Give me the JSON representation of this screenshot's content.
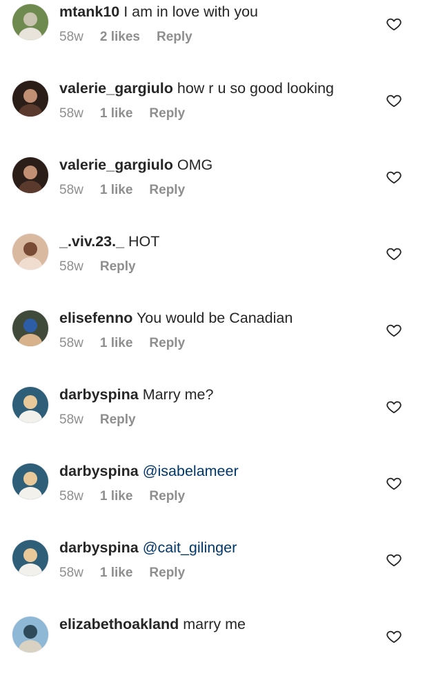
{
  "comments": [
    {
      "username": "mtank10",
      "text": "I am in love with you",
      "age": "58w",
      "likes": "2 likes",
      "reply": "Reply",
      "mention": false,
      "avatar": "avatar-outdoor-photo",
      "avatar_colors": [
        "#6f8a4e",
        "#c9c4b0",
        "#e8e4dc"
      ]
    },
    {
      "username": "valerie_gargiulo",
      "text": "how r u so good looking",
      "age": "58w",
      "likes": "1 like",
      "reply": "Reply",
      "mention": false,
      "avatar": "avatar-portrait-photo",
      "avatar_colors": [
        "#2b1d18",
        "#c08f74",
        "#5a3a2c"
      ]
    },
    {
      "username": "valerie_gargiulo",
      "text": "OMG",
      "age": "58w",
      "likes": "1 like",
      "reply": "Reply",
      "mention": false,
      "avatar": "avatar-portrait-photo",
      "avatar_colors": [
        "#2b1d18",
        "#c08f74",
        "#5a3a2c"
      ]
    },
    {
      "username": "_.viv.23._",
      "text": "HOT",
      "age": "58w",
      "likes": "",
      "reply": "Reply",
      "mention": false,
      "avatar": "avatar-portrait-photo",
      "avatar_colors": [
        "#d9b9a0",
        "#7a4b34",
        "#f1ddd0"
      ]
    },
    {
      "username": "elisefenno",
      "text": "You would be Canadian",
      "age": "58w",
      "likes": "1 like",
      "reply": "Reply",
      "mention": false,
      "avatar": "avatar-group-photo",
      "avatar_colors": [
        "#3f4a3a",
        "#2c5da6",
        "#d8b28a"
      ]
    },
    {
      "username": "darbyspina",
      "text": "Marry me?",
      "age": "58w",
      "likes": "",
      "reply": "Reply",
      "mention": false,
      "avatar": "avatar-portrait-photo",
      "avatar_colors": [
        "#2f5f78",
        "#e9c99a",
        "#f3f1ec"
      ]
    },
    {
      "username": "darbyspina",
      "text": "@isabelameer",
      "age": "58w",
      "likes": "1 like",
      "reply": "Reply",
      "mention": true,
      "avatar": "avatar-portrait-photo",
      "avatar_colors": [
        "#2f5f78",
        "#e9c99a",
        "#f3f1ec"
      ]
    },
    {
      "username": "darbyspina",
      "text": "@cait_gilinger",
      "age": "58w",
      "likes": "1 like",
      "reply": "Reply",
      "mention": true,
      "avatar": "avatar-portrait-photo",
      "avatar_colors": [
        "#2f5f78",
        "#e9c99a",
        "#f3f1ec"
      ]
    },
    {
      "username": "elizabethoakland",
      "text": "marry me",
      "age": "",
      "likes": "",
      "reply": "",
      "mention": false,
      "avatar": "avatar-beach-photo",
      "avatar_colors": [
        "#8fb8d6",
        "#2f4a5a",
        "#d9d1c2"
      ]
    }
  ],
  "icons": {
    "like": "heart-outline-icon"
  },
  "colors": {
    "username": "#262626",
    "text": "#262626",
    "meta": "#8e8e8e",
    "mention": "#00376b",
    "heart": "#262626"
  }
}
